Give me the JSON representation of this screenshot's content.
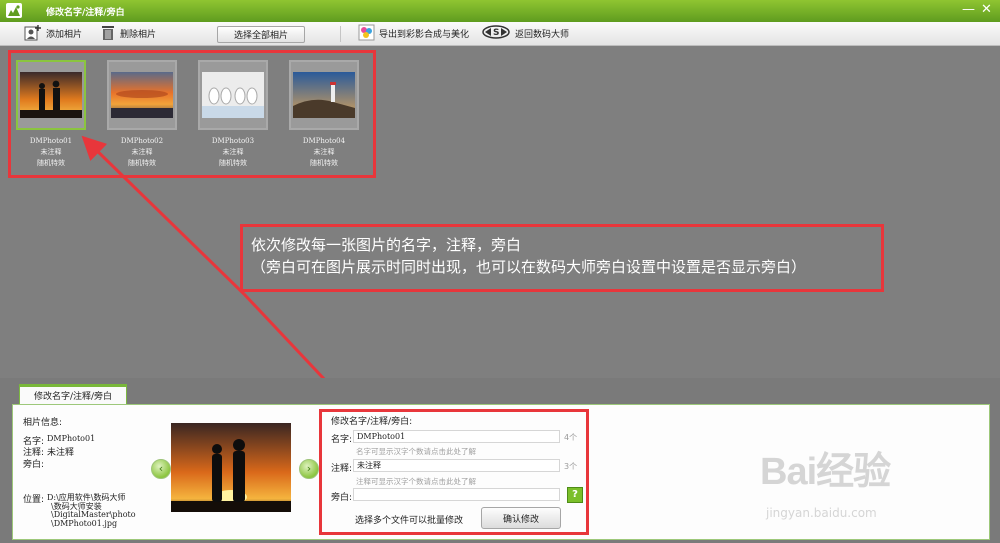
{
  "window": {
    "title": "修改名字/注释/旁白",
    "minimize_label": "—",
    "close_label": "✕"
  },
  "toolbar": {
    "add_photo": "添加相片",
    "delete_photo": "删除相片",
    "select_all": "选择全部相片",
    "export": "导出到彩影合成与美化",
    "return": "返回数码大师"
  },
  "photos": [
    {
      "name": "DMPhoto01",
      "note": "未注释",
      "effect": "随机特效",
      "selected": true,
      "scene": "sunset-couple"
    },
    {
      "name": "DMPhoto02",
      "note": "未注释",
      "effect": "随机特效",
      "selected": false,
      "scene": "sunset-clouds"
    },
    {
      "name": "DMPhoto03",
      "note": "未注释",
      "effect": "随机特效",
      "selected": false,
      "scene": "flip-flops"
    },
    {
      "name": "DMPhoto04",
      "note": "未注释",
      "effect": "随机特效",
      "selected": false,
      "scene": "lighthouse"
    }
  ],
  "annotation": {
    "line1": "依次修改每一张图片的名字，注释，旁白",
    "line2": "（旁白可在图片展示时同时出现，也可以在数码大师旁白设置中设置是否显示旁白）"
  },
  "bottom": {
    "tab_label": "修改名字/注释/旁白",
    "info": {
      "heading": "相片信息:",
      "name_label": "名字:",
      "name_value": "DMPhoto01",
      "note_label": "注释:",
      "note_value": "未注释",
      "narration_label": "旁白:",
      "location_label": "位置:",
      "location_lines": [
        "D:\\应用软件\\数码大师",
        "\\数码大师安装",
        "\\DigitalMaster\\photo",
        "\\DMPhoto01.jpg"
      ]
    },
    "nav": {
      "prev": "‹",
      "next": "›"
    },
    "edit": {
      "heading": "修改名字/注释/旁白:",
      "name_label": "名字:",
      "name_value": "DMPhoto01",
      "name_count": "4个",
      "name_hint": "名字可显示汉字个数请点击此处了解",
      "note_label": "注释:",
      "note_value": "未注释",
      "note_count": "3个",
      "note_hint": "注释可显示汉字个数请点击此处了解",
      "narration_label": "旁白:",
      "narration_value": "",
      "help": "?",
      "batch_hint": "选择多个文件可以批量修改",
      "confirm": "确认修改"
    }
  },
  "watermark": {
    "brand": "Bai经验",
    "url": "jingyan.baidu.com"
  },
  "colors": {
    "accent_green": "#7bbf2a",
    "annotation_red": "#e8363b",
    "gallery_bg": "#7f7f7f"
  }
}
